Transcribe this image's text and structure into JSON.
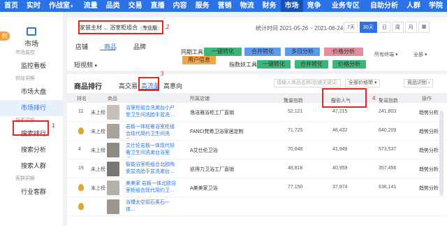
{
  "topnav": {
    "items": [
      "首页",
      "实时",
      "作战室",
      "流量",
      "品类",
      "交易",
      "直播",
      "内容",
      "服务",
      "营销",
      "物流",
      "财务",
      "市场",
      "竞争",
      "业务专区",
      "自助分析",
      "人群",
      "学院"
    ],
    "active_index": 12
  },
  "sidebar": {
    "title": "市场",
    "new_badge": "时",
    "sections": [
      {
        "label": "市场监控",
        "items": [
          "监控看板"
        ]
      },
      {
        "label": "供给洞察",
        "items": [
          "市场大盘",
          "市场排行"
        ]
      },
      {
        "label": "搜索洞察",
        "items": [
          "搜索排行",
          "搜索分析",
          "搜索人群"
        ]
      },
      {
        "label": "客群洞察",
        "items": [
          "行业客群"
        ]
      }
    ],
    "active_item": "市场排行"
  },
  "filterbar": {
    "category": "家装主材 ... 浴室柜组合",
    "tag": "专业版",
    "chevron": "⌄",
    "stat_time": "统计时间 2021-05-26 ~ 2021-06-24",
    "ranges": [
      "7天",
      "30天",
      "日",
      "周",
      "月"
    ],
    "active_range": "30天"
  },
  "tabs": {
    "items": [
      "店铺",
      "商品",
      "品牌"
    ],
    "active": "商品",
    "short_video": "短视频",
    "tools_label": "同期工具:",
    "tools": [
      "一键转化",
      "合并转化",
      "多日分析",
      "价格分析"
    ],
    "user_info": "用户信息",
    "index_tools_label": "指数妖工具:",
    "index_tools": [
      "一键转化",
      "合并转化",
      "价格分析"
    ],
    "terminal": "所有终端",
    "all": "全部"
  },
  "ranking": {
    "title": "商品排行",
    "subtabs": [
      "高交易",
      "高流量",
      "高意向"
    ],
    "active_subtab": "高流量",
    "search_placeholder": "请输入商品名称/店铺关键词",
    "all_dropdown": "全部价格带",
    "recognize": "竞品识别",
    "columns": [
      "排名",
      "商品",
      "所属店铺",
      "流量指数",
      "搜索人气",
      "交易指数",
      "操作"
    ],
    "rows": [
      {
        "rank": "11",
        "status": "未上榜",
        "name": "浴室柜组合洗漱台小户型卫生间洗脸手盆洗…",
        "shop": "逸洁雅浴柜工厂直销",
        "flow": "52,121",
        "search": "47,215",
        "trade": "241,803",
        "action": "趋势分析",
        "medal": false
      },
      {
        "rank": "",
        "status": "未上榜",
        "name": "岩板一体轻奢浴室柜组合现代简约卫生间洗手…",
        "shop": "FANCI梵希卫浴家居定制",
        "flow": "71,725",
        "search": "46,432",
        "trade": "640,209",
        "action": "趋势分析",
        "medal": true
      },
      {
        "rank": "4",
        "status": "未上榜",
        "name": "艾仕伦岩板一体现代轻奢卫生间洗漱台浴室柜…",
        "shop": "A艾仕伦卫浴",
        "flow": "70,648",
        "search": "41,949",
        "trade": "573,537",
        "action": "趋势分析",
        "medal": false
      },
      {
        "rank": "19",
        "status": "未上榜",
        "name": "智能浴室柜组合北欧陶瓷盆洗脸手盆洗漱台…",
        "shop": "凯得力卫浴工厂直销",
        "flow": "48,818",
        "search": "40,959",
        "trade": "357,456",
        "action": "趋势分析",
        "medal": false
      },
      {
        "rank": "",
        "status": "未上榜",
        "name": "美美家 岩板一体北欧浴室柜组合现代简约卫…",
        "shop": "A美美家卫浴",
        "flow": "77,150",
        "search": "37,974",
        "trade": "636,141",
        "action": "趋势分析",
        "medal": true
      },
      {
        "rank": "",
        "status": "",
        "name": "浴槽太空铝石英石一体…",
        "shop": "",
        "flow": "",
        "search": "",
        "trade": "",
        "action": "",
        "medal": true
      }
    ]
  },
  "annotations": [
    "1",
    "2",
    "3",
    "4"
  ],
  "colors": {
    "primary": "#2a72e5",
    "annotation": "#e8241f"
  }
}
